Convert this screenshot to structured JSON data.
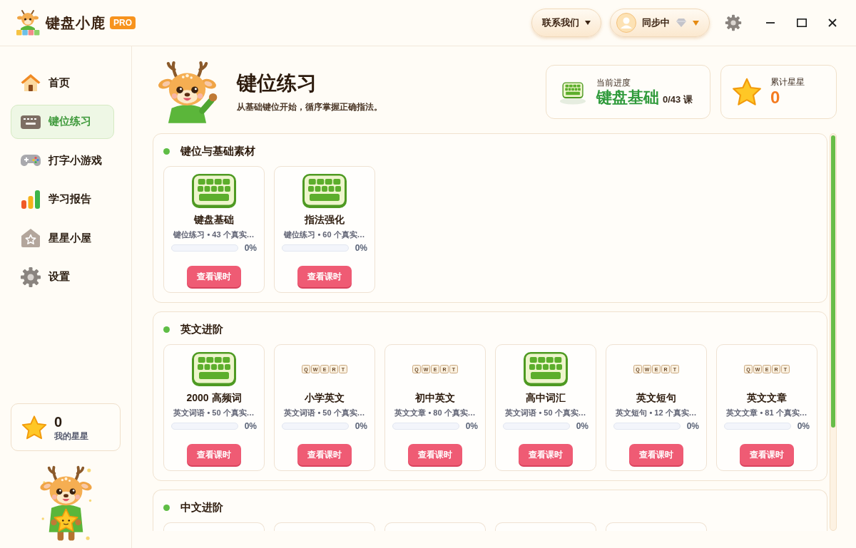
{
  "app": {
    "title": "键盘小鹿",
    "badge": "PRO"
  },
  "top_bar": {
    "contact_button": "联系我们",
    "sync_button": "同步中"
  },
  "sidebar": {
    "items": [
      {
        "kind": "home",
        "label": "首页",
        "selected": false
      },
      {
        "kind": "keyboard",
        "label": "键位练习",
        "selected": true
      },
      {
        "kind": "gamepad",
        "label": "打字小游戏",
        "selected": false
      },
      {
        "kind": "chart",
        "label": "学习报告",
        "selected": false
      },
      {
        "kind": "star-house",
        "label": "星星小屋",
        "selected": false
      },
      {
        "kind": "gear",
        "label": "设置",
        "selected": false
      }
    ],
    "stars_card": {
      "count": "0",
      "label": "我的星星"
    }
  },
  "header": {
    "title": "键位练习",
    "subtitle": "从基础键位开始，循序掌握正确指法。",
    "progress_card": {
      "label": "当前进度",
      "course": "键盘基础",
      "count": "0/43 课"
    },
    "stars_card": {
      "label": "累计星星",
      "count": "0"
    }
  },
  "sections": [
    {
      "title": "键位与基础素材",
      "cards": [
        {
          "kind": "keyboard",
          "title": "键盘基础",
          "meta": "键位练习 • 43 个真实…",
          "level": 0,
          "reading": "0%",
          "button": "查看课时"
        },
        {
          "kind": "keyboard",
          "title": "指法强化",
          "meta": "键位练习 • 60 个真实…",
          "level": 0,
          "reading": "0%",
          "button": "查看课时"
        }
      ]
    },
    {
      "title": "英文进阶",
      "cards": [
        {
          "kind": "keyboard",
          "title": "2000 高频词",
          "meta": "英文词语 • 50 个真实…",
          "level": 0,
          "reading": "0%",
          "button": "查看课时"
        },
        {
          "kind": "keycaps",
          "keys": [
            "Q",
            "W",
            "E",
            "R",
            "T"
          ],
          "title": "小学英文",
          "meta": "英文词语 • 50 个真实…",
          "level": 0,
          "reading": "0%",
          "button": "查看课时"
        },
        {
          "kind": "keycaps",
          "keys": [
            "Q",
            "W",
            "E",
            "R",
            "T"
          ],
          "title": "初中英文",
          "meta": "英文文章 • 80 个真实…",
          "level": 0,
          "reading": "0%",
          "button": "查看课时"
        },
        {
          "kind": "keyboard",
          "title": "高中词汇",
          "meta": "英文词语 • 50 个真实…",
          "level": 0,
          "reading": "0%",
          "button": "查看课时"
        },
        {
          "kind": "keycaps",
          "keys": [
            "Q",
            "W",
            "E",
            "R",
            "T"
          ],
          "title": "英文短句",
          "meta": "英文短句 • 12 个真实…",
          "level": 0,
          "reading": "0%",
          "button": "查看课时"
        },
        {
          "kind": "keycaps",
          "keys": [
            "Q",
            "W",
            "E",
            "R",
            "T"
          ],
          "title": "英文文章",
          "meta": "英文文章 • 81 个真实…",
          "level": 0,
          "reading": "0%",
          "button": "查看课时"
        }
      ]
    },
    {
      "title": "中文进阶",
      "cards": [
        {
          "kind": "clipped"
        },
        {
          "kind": "clipped"
        },
        {
          "kind": "clipped"
        },
        {
          "kind": "clipped"
        },
        {
          "kind": "clipped"
        }
      ]
    }
  ]
}
